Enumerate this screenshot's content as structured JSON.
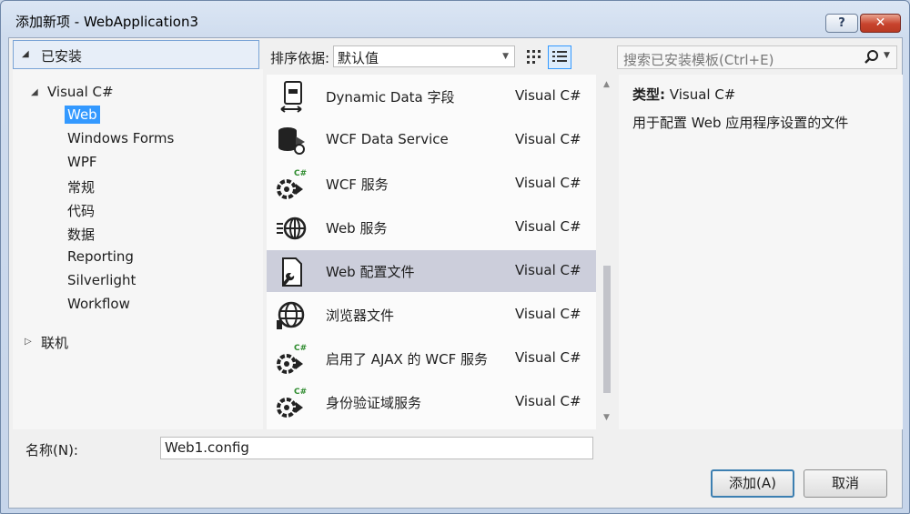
{
  "window": {
    "title": "添加新项 - WebApplication3",
    "help_label": "?",
    "close_label": "✕"
  },
  "left": {
    "installed_label": "已安装",
    "tree": {
      "root_label": "Visual C#",
      "children": [
        "Web",
        "Windows Forms",
        "WPF",
        "常规",
        "代码",
        "数据",
        "Reporting",
        "Silverlight",
        "Workflow"
      ],
      "selected": "Web",
      "online_label": "联机"
    }
  },
  "toolbar": {
    "sort_label": "排序依据:",
    "sort_value": "默认值",
    "search_placeholder": "搜索已安装模板(Ctrl+E)"
  },
  "templates": [
    {
      "name": "Dynamic Data 字段",
      "lang": "Visual C#",
      "icon": "dynamic-data-icon"
    },
    {
      "name": "WCF Data Service",
      "lang": "Visual C#",
      "icon": "data-service-icon"
    },
    {
      "name": "WCF 服务",
      "lang": "Visual C#",
      "icon": "wcf-service-icon"
    },
    {
      "name": "Web 服务",
      "lang": "Visual C#",
      "icon": "web-service-icon"
    },
    {
      "name": "Web 配置文件",
      "lang": "Visual C#",
      "icon": "config-file-icon",
      "selected": true
    },
    {
      "name": "浏览器文件",
      "lang": "Visual C#",
      "icon": "browser-file-icon"
    },
    {
      "name": "启用了 AJAX 的 WCF 服务",
      "lang": "Visual C#",
      "icon": "wcf-service-icon"
    },
    {
      "name": "身份验证域服务",
      "lang": "Visual C#",
      "icon": "wcf-service-icon"
    }
  ],
  "details": {
    "type_label": "类型:",
    "type_value": "Visual C#",
    "description": "用于配置 Web 应用程序设置的文件"
  },
  "footer": {
    "name_label": "名称(N):",
    "name_value": "Web1.config",
    "add_label": "添加(A)",
    "cancel_label": "取消"
  },
  "colors": {
    "selection": "#3399ff",
    "list_selected": "#cccedb"
  }
}
